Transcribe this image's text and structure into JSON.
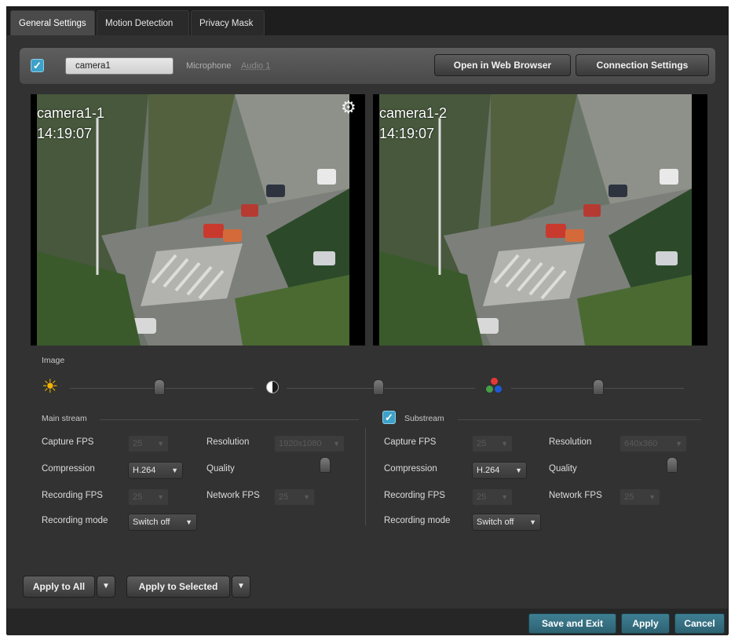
{
  "tabs": [
    {
      "label": "General Settings"
    },
    {
      "label": "Motion Detection"
    },
    {
      "label": "Privacy Mask"
    }
  ],
  "camera": {
    "name_value": "camera1",
    "microphone_label": "Microphone",
    "microphone_value": "Audio 1",
    "open_browser_label": "Open in Web Browser",
    "connection_settings_label": "Connection Settings"
  },
  "videos": [
    {
      "name": "camera1-1",
      "time": "14:19:07"
    },
    {
      "name": "camera1-2",
      "time": "14:19:07"
    }
  ],
  "image": {
    "title": "Image",
    "brightness_icon": "sun-icon",
    "contrast_icon": "contrast-icon",
    "saturation_icon": "rgb-dots-icon"
  },
  "main_stream": {
    "title": "Main stream",
    "capture_fps_label": "Capture FPS",
    "capture_fps_value": "25",
    "resolution_label": "Resolution",
    "resolution_value": "1920x1080",
    "compression_label": "Compression",
    "compression_value": "H.264",
    "quality_label": "Quality",
    "recording_fps_label": "Recording FPS",
    "recording_fps_value": "25",
    "network_fps_label": "Network FPS",
    "network_fps_value": "25",
    "recording_mode_label": "Recording mode",
    "recording_mode_value": "Switch off"
  },
  "substream": {
    "title": "Substream",
    "enabled": true,
    "capture_fps_label": "Capture FPS",
    "capture_fps_value": "25",
    "resolution_label": "Resolution",
    "resolution_value": "640x360",
    "compression_label": "Compression",
    "compression_value": "H.264",
    "quality_label": "Quality",
    "recording_fps_label": "Recording FPS",
    "recording_fps_value": "25",
    "network_fps_label": "Network FPS",
    "network_fps_value": "25",
    "recording_mode_label": "Recording mode",
    "recording_mode_value": "Switch off"
  },
  "actions": {
    "apply_all_label": "Apply to All",
    "apply_selected_label": "Apply to Selected"
  },
  "footer": {
    "save_exit_label": "Save and Exit",
    "apply_label": "Apply",
    "cancel_label": "Cancel"
  },
  "colors": {
    "accent": "#3ea1c9",
    "footer_button": "#35707f"
  }
}
